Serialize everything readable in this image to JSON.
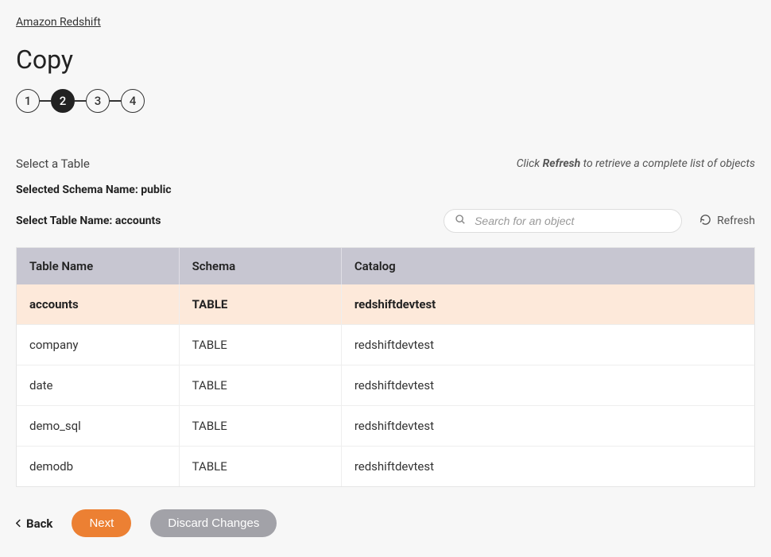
{
  "breadcrumb": {
    "label": "Amazon Redshift"
  },
  "page": {
    "title": "Copy"
  },
  "stepper": {
    "steps": [
      "1",
      "2",
      "3",
      "4"
    ],
    "active_index": 1
  },
  "section": {
    "title": "Select a Table",
    "refresh_hint_prefix": "Click ",
    "refresh_hint_bold": "Refresh",
    "refresh_hint_suffix": " to retrieve a complete list of objects"
  },
  "info": {
    "schema_line": "Selected Schema Name: public",
    "table_line": "Select Table Name: accounts"
  },
  "search": {
    "placeholder": "Search for an object"
  },
  "refresh": {
    "label": "Refresh"
  },
  "table": {
    "columns": {
      "name": "Table Name",
      "schema": "Schema",
      "catalog": "Catalog"
    },
    "rows": [
      {
        "name": "accounts",
        "schema": "TABLE",
        "catalog": "redshiftdevtest",
        "selected": true
      },
      {
        "name": "company",
        "schema": "TABLE",
        "catalog": "redshiftdevtest",
        "selected": false
      },
      {
        "name": "date",
        "schema": "TABLE",
        "catalog": "redshiftdevtest",
        "selected": false
      },
      {
        "name": "demo_sql",
        "schema": "TABLE",
        "catalog": "redshiftdevtest",
        "selected": false
      },
      {
        "name": "demodb",
        "schema": "TABLE",
        "catalog": "redshiftdevtest",
        "selected": false
      }
    ]
  },
  "actions": {
    "back": "Back",
    "next": "Next",
    "discard": "Discard Changes"
  }
}
